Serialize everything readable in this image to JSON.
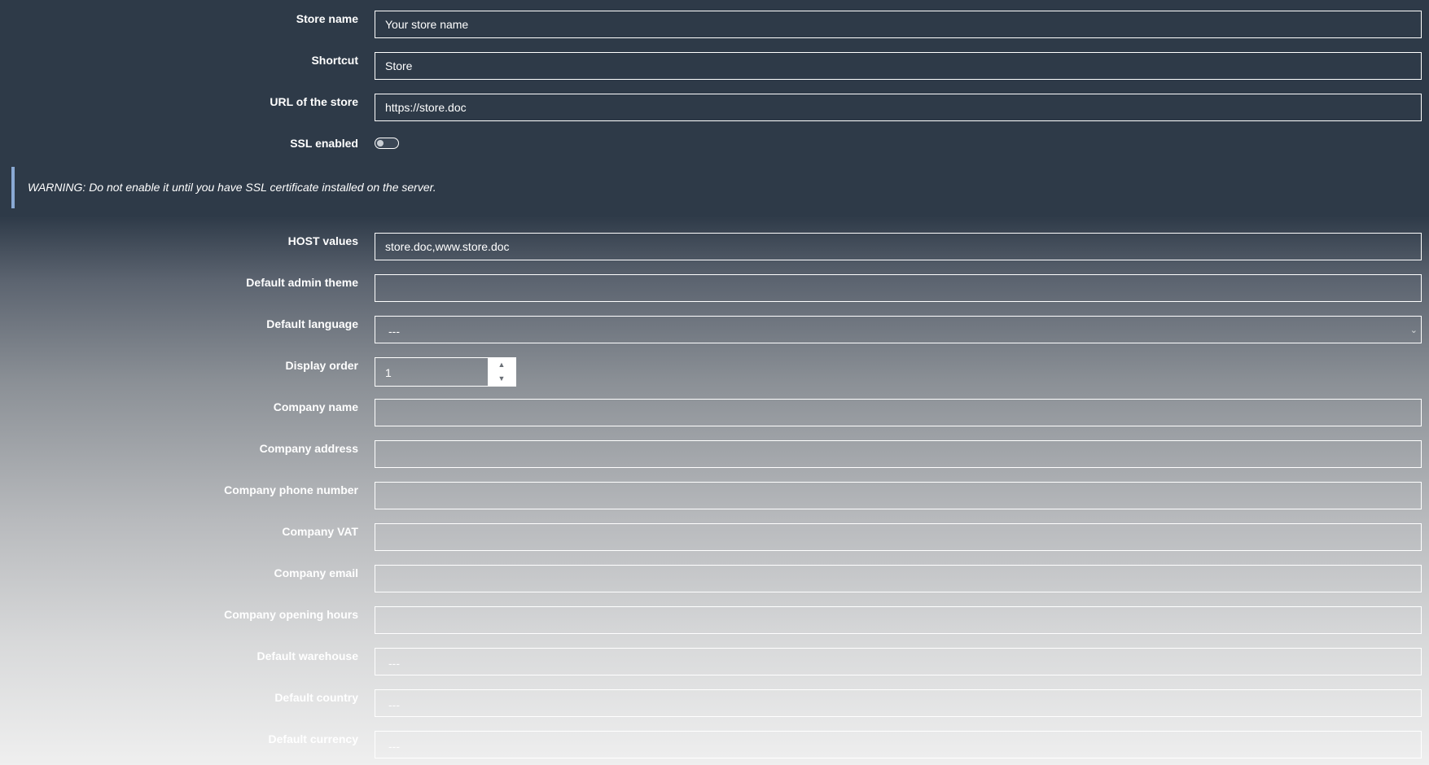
{
  "form": {
    "store_name": {
      "label": "Store name",
      "value": "Your store name"
    },
    "shortcut": {
      "label": "Shortcut",
      "value": "Store"
    },
    "url": {
      "label": "URL of the store",
      "value": "https://store.doc"
    },
    "ssl": {
      "label": "SSL enabled",
      "enabled": false
    },
    "warning": "WARNING: Do not enable it until you have SSL certificate installed on the server.",
    "host_values": {
      "label": "HOST values",
      "value": "store.doc,www.store.doc"
    },
    "admin_theme": {
      "label": "Default admin theme",
      "value": ""
    },
    "language": {
      "label": "Default language",
      "value": "---"
    },
    "display_order": {
      "label": "Display order",
      "value": "1"
    },
    "company_name": {
      "label": "Company name",
      "value": ""
    },
    "company_address": {
      "label": "Company address",
      "value": ""
    },
    "company_phone": {
      "label": "Company phone number",
      "value": ""
    },
    "company_vat": {
      "label": "Company VAT",
      "value": ""
    },
    "company_email": {
      "label": "Company email",
      "value": ""
    },
    "company_hours": {
      "label": "Company opening hours",
      "value": ""
    },
    "warehouse": {
      "label": "Default warehouse",
      "value": "---"
    },
    "country": {
      "label": "Default country",
      "value": "---"
    },
    "currency": {
      "label": "Default currency",
      "value": "---"
    }
  },
  "icons": {
    "select_arrow": "chevron-down-icon",
    "spin_up": "caret-up-icon",
    "spin_down": "caret-down-icon"
  },
  "colors": {
    "header_background": "#2e3a48",
    "warning_accent": "#8aa9d4",
    "toggle_knob": "#c9ced4"
  }
}
